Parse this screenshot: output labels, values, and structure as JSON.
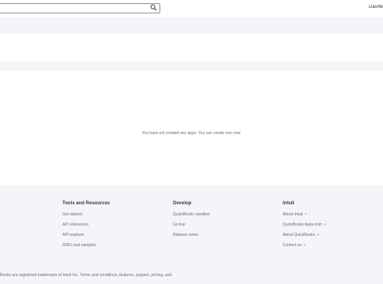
{
  "header": {
    "search_placeholder": "",
    "dashboard_label": "Dashbo"
  },
  "main": {
    "empty_message": "You have not created any apps. You can create one now."
  },
  "footer": {
    "columns": [
      {
        "heading": "Tools and Resources",
        "links": [
          "Get started",
          "API references",
          "API explorer",
          "SDKs and samples"
        ]
      },
      {
        "heading": "Develop",
        "links": [
          "QuickBooks sandbox",
          "Go live",
          "Release notes"
        ]
      },
      {
        "heading": "Intuit",
        "links": [
          "About Intuit",
          "QuickBooks Apps.com",
          "About QuickBooks",
          "Contact us"
        ]
      }
    ],
    "legal": "Books are registered trademarks of Intuit Inc. Terms and conditions, features, support, pricing, and"
  },
  "icons": {
    "search": "search-icon",
    "external": "external-link-icon"
  },
  "colors": {
    "band": "#f4f5f8",
    "text": "#393a3d",
    "muted": "#6b6c72"
  }
}
